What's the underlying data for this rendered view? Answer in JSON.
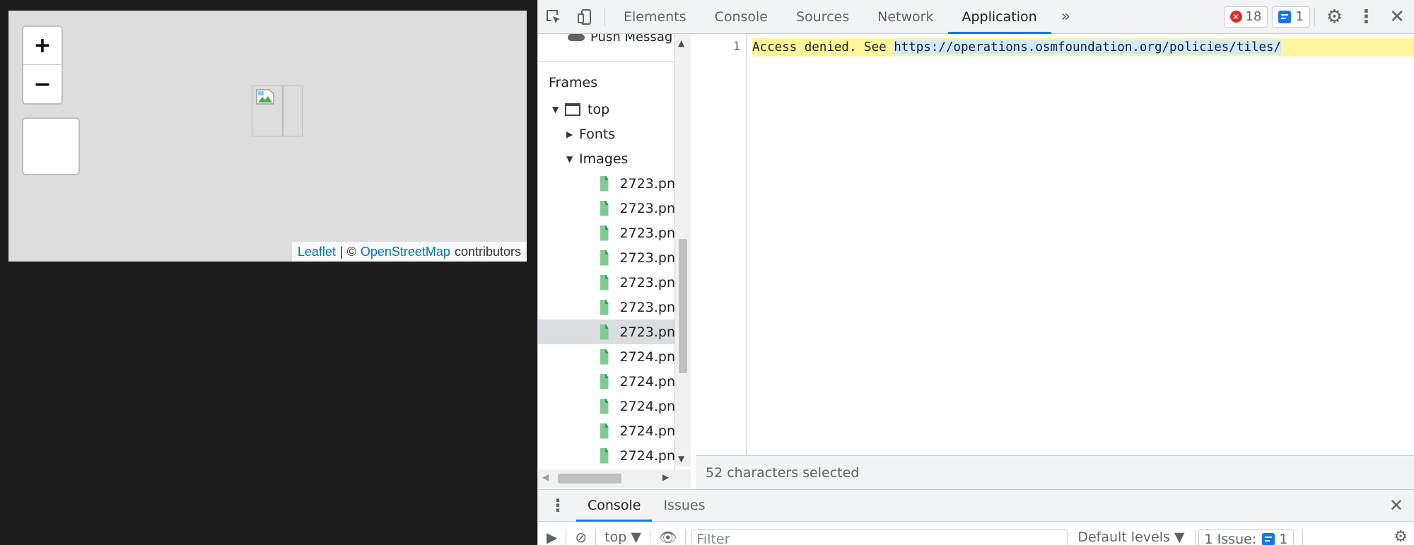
{
  "map": {
    "zoom_in_label": "+",
    "zoom_out_label": "−",
    "attribution": {
      "leaflet": "Leaflet",
      "separator": "| ©",
      "osm": "OpenStreetMap",
      "suffix": "contributors"
    },
    "link_color": "#0078a8"
  },
  "devtools": {
    "tabs": [
      "Elements",
      "Console",
      "Sources",
      "Network",
      "Application"
    ],
    "active_tab": "Application",
    "more_tabs_label": "»",
    "error_count": "18",
    "message_count": "1",
    "sidebar": {
      "push_messaging": "Push Messag",
      "frames_heading": "Frames",
      "tree": {
        "top": "top",
        "fonts": "Fonts",
        "images": "Images"
      },
      "files": [
        "2723.pn",
        "2723.pn",
        "2723.pn",
        "2723.pn",
        "2723.pn",
        "2723.pn",
        "2723.pn",
        "2724.pn",
        "2724.pn",
        "2724.pn",
        "2724.pn",
        "2724.pn"
      ],
      "selected_index": 6
    },
    "editor": {
      "line_number": "1",
      "text_before": "Access denied. See ",
      "selected_text": "https://operations.osmfoundation.org/policies/tiles/",
      "highlight_color": "#fff59d"
    },
    "status": "52 characters selected",
    "drawer": {
      "tabs": [
        "Console",
        "Issues"
      ],
      "active_tab": "Console"
    },
    "console_bar": {
      "context": "top",
      "filter_placeholder": "Filter",
      "levels": "Default levels",
      "issues_label": "1 Issue:",
      "issues_count": "1"
    },
    "accent_color": "#1a73e8",
    "error_color": "#d93025"
  }
}
